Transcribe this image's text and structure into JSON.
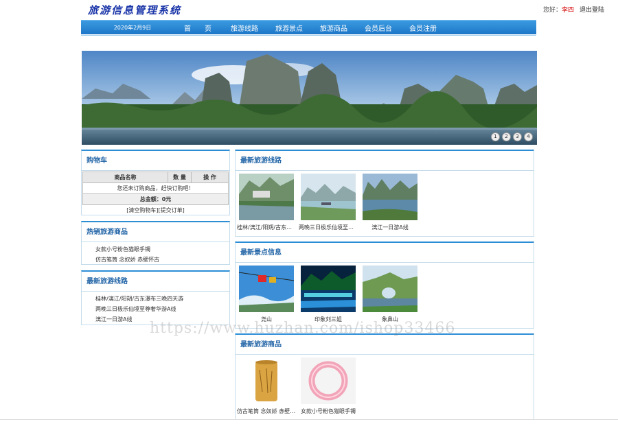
{
  "header": {
    "logo_text": "旅游信息管理系统",
    "greeting": "您好：",
    "username": "李四",
    "logout": "退出登陆"
  },
  "nav": {
    "date": "2020年2月9日",
    "items": [
      "首　　页",
      "旅游线路",
      "旅游景点",
      "旅游商品",
      "会员后台",
      "会员注册"
    ]
  },
  "banner": {
    "dots": [
      "1",
      "2",
      "3",
      "4"
    ]
  },
  "cart": {
    "title": "购物车",
    "columns": [
      "商品名称",
      "数 量",
      "操 作"
    ],
    "empty_msg": "您还未订购商品，赶快订购吧！",
    "total": "总金额：0元",
    "clear": "[清空购物车]",
    "submit": "[提交订单]"
  },
  "hot_goods": {
    "title": "热销旅游商品",
    "items": [
      "女款小号粉色猫眼手镯",
      "仿古笔筒 念奴娇 赤壁怀古"
    ]
  },
  "side_routes": {
    "title": "最新旅游线路",
    "items": [
      "桂林/漓江/阳朔/古东瀑布三晚四天游",
      "两晚三日极乐仙境至尊奢华游A线",
      "漓江一日游A线"
    ]
  },
  "routes": {
    "title": "最新旅游线路",
    "items": [
      "桂林/漓江/阳朔/古东瀑布三晚四天游",
      "两晚三日极乐仙境至尊奢华游A线",
      "漓江一日游A线"
    ]
  },
  "spots": {
    "title": "最新景点信息",
    "items": [
      "尧山",
      "印象刘三姐",
      "象鼻山"
    ]
  },
  "goods": {
    "title": "最新旅游商品",
    "items": [
      "仿古笔筒 念奴娇 赤壁怀古",
      "女款小号粉色猫眼手镯"
    ]
  },
  "watermark": "https://www.huzhan.com/ishop33466"
}
